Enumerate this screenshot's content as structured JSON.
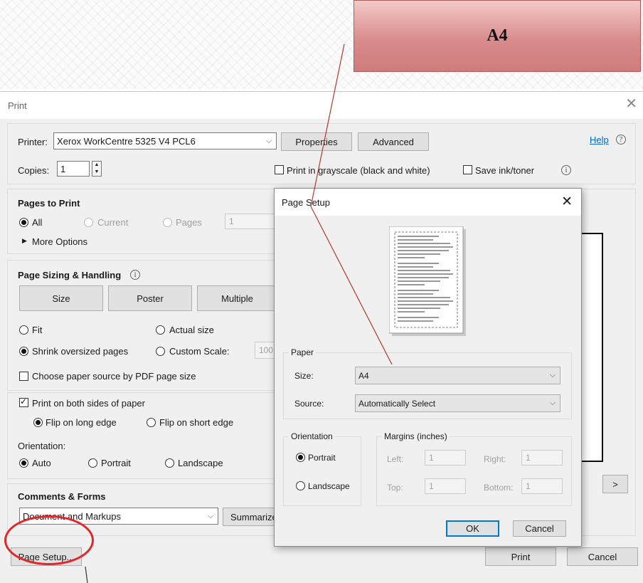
{
  "callout": {
    "text": "A4"
  },
  "print": {
    "title": "Print",
    "printer_label": "Printer:",
    "printer_value": "Xerox WorkCentre 5325 V4 PCL6",
    "properties": "Properties",
    "advanced": "Advanced",
    "help": "Help",
    "copies_label": "Copies:",
    "copies_value": "1",
    "grayscale": "Print in grayscale (black and white)",
    "save_ink": "Save ink/toner",
    "pages_to_print": {
      "heading": "Pages to Print",
      "all": "All",
      "current": "Current",
      "pages": "Pages",
      "pages_value": "1",
      "more_options": "More Options"
    },
    "sizing": {
      "heading": "Page Sizing & Handling",
      "size": "Size",
      "poster": "Poster",
      "multiple": "Multiple",
      "fit": "Fit",
      "actual_size": "Actual size",
      "shrink": "Shrink oversized pages",
      "custom_scale": "Custom Scale:",
      "custom_value": "100",
      "paper_source": "Choose paper source by PDF page size"
    },
    "duplex": {
      "both_sides": "Print on both sides of paper",
      "long_edge": "Flip on long edge",
      "short_edge": "Flip on short edge",
      "orientation_label": "Orientation:",
      "auto": "Auto",
      "portrait": "Portrait",
      "landscape": "Landscape"
    },
    "comments": {
      "heading": "Comments & Forms",
      "value": "Document and Markups",
      "summarize": "Summarize"
    },
    "next": ">",
    "page_setup": "Page Setup...",
    "print_btn": "Print",
    "cancel_btn": "Cancel"
  },
  "page_setup": {
    "title": "Page Setup",
    "paper_group": "Paper",
    "size_label": "Size:",
    "size_value": "A4",
    "source_label": "Source:",
    "source_value": "Automatically Select",
    "orientation_group": "Orientation",
    "portrait": "Portrait",
    "landscape": "Landscape",
    "margins_group": "Margins (inches)",
    "left_label": "Left:",
    "left_value": "1",
    "right_label": "Right:",
    "right_value": "1",
    "top_label": "Top:",
    "top_value": "1",
    "bottom_label": "Bottom:",
    "bottom_value": "1",
    "ok": "OK",
    "cancel": "Cancel"
  },
  "colors": {
    "callout": "#d98c8c",
    "annotation_line": "#b03a2e",
    "highlight_circle": "#e0282a",
    "link": "#0066cc",
    "ok_border": "#0078d7"
  }
}
